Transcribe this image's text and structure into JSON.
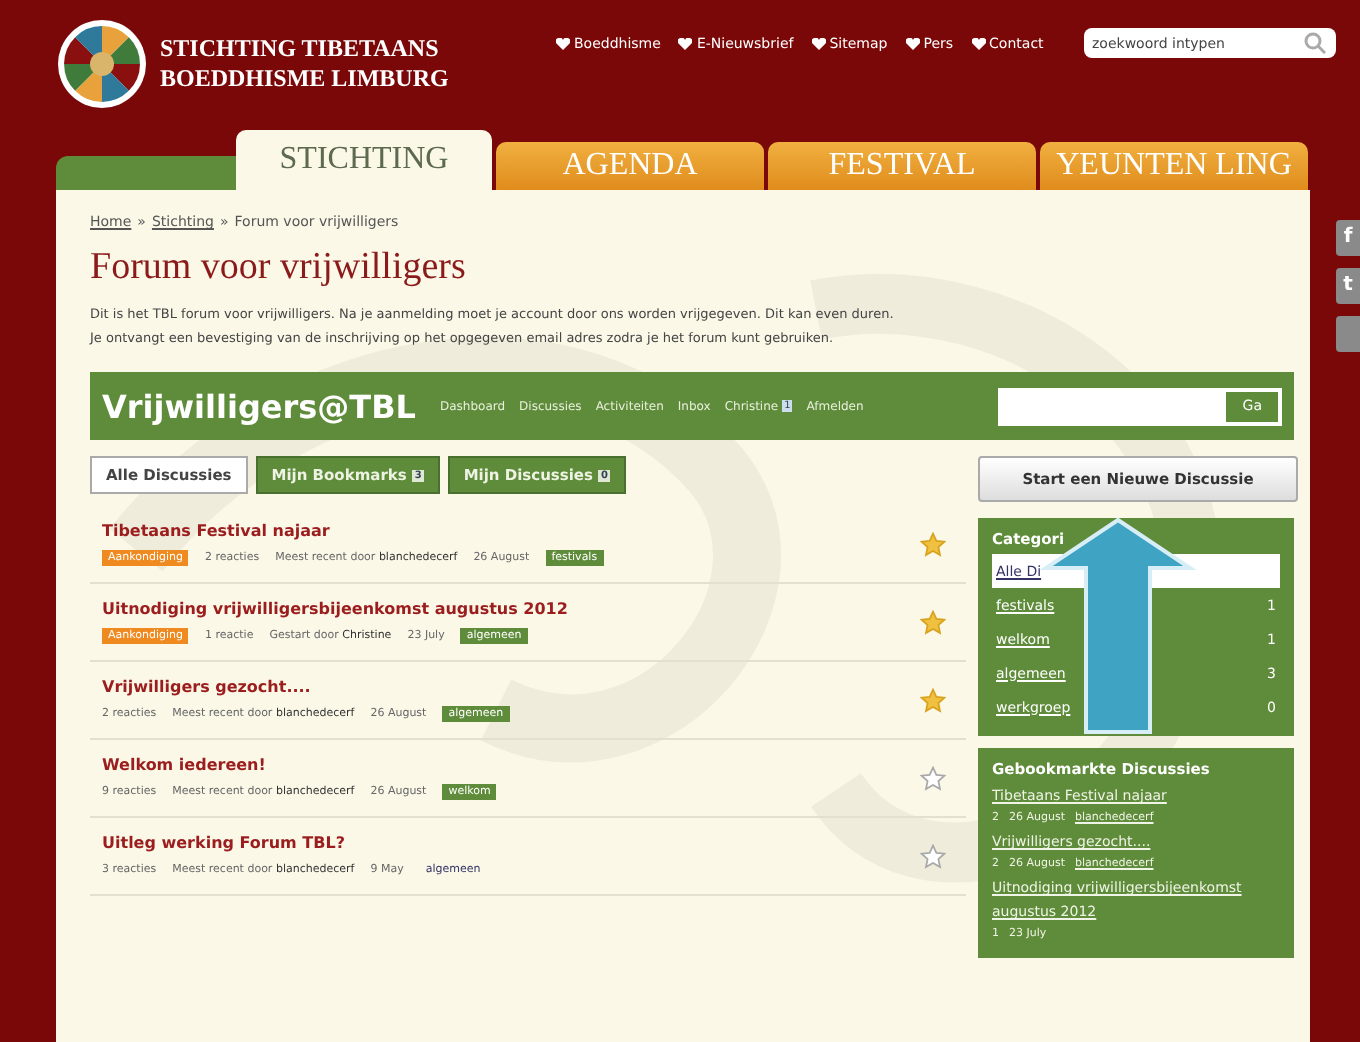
{
  "site": {
    "title_line1": "STICHTING TIBETAANS",
    "title_line2": "BOEDDHISME LIMBURG"
  },
  "top_links": [
    "Boeddhisme",
    "E-Nieuwsbrief",
    "Sitemap",
    "Pers",
    "Contact"
  ],
  "site_search": {
    "placeholder": "zoekwoord intypen"
  },
  "tabs": [
    {
      "label": "STICHTING",
      "selected": true
    },
    {
      "label": "AGENDA",
      "selected": false
    },
    {
      "label": "FESTIVAL",
      "selected": false
    },
    {
      "label": "YEUNTEN LING",
      "selected": false
    }
  ],
  "side_tabs": [
    "f",
    "t"
  ],
  "breadcrumb": [
    {
      "label": "Home",
      "link": true
    },
    {
      "label": "Stichting",
      "link": true
    },
    {
      "label": "Forum voor vrijwilligers",
      "link": false
    }
  ],
  "breadcrumb_separator": "»",
  "page_title": "Forum voor vrijwilligers",
  "intro": [
    "Dit is het TBL forum voor vrijwilligers. Na je aanmelding moet je account door ons worden vrijgegeven. Dit kan even duren.",
    "Je ontvangt een bevestiging van de inschrijving op het opgegeven email adres zodra je het forum kunt gebruiken."
  ],
  "forum": {
    "name": "Vrijwilligers@TBL",
    "nav": [
      {
        "label": "Dashboard"
      },
      {
        "label": "Discussies"
      },
      {
        "label": "Activiteiten"
      },
      {
        "label": "Inbox"
      },
      {
        "label": "Christine",
        "badge": "1"
      },
      {
        "label": "Afmelden"
      }
    ],
    "search_button": "Ga"
  },
  "filters": [
    {
      "label": "Alle Discussies",
      "selected": true
    },
    {
      "label": "Mijn Bookmarks",
      "badge": "3",
      "selected": false
    },
    {
      "label": "Mijn Discussies",
      "badge": "0",
      "selected": false
    }
  ],
  "discussions": [
    {
      "title": "Tibetaans Festival najaar",
      "announcement": "Aankondiging",
      "replies": "2 reacties",
      "by_label": "Meest recent door",
      "author": "blanchedecerf",
      "date": "26 August",
      "tag": {
        "label": "festivals",
        "kind": "green"
      },
      "bookmarked": true
    },
    {
      "title": "Uitnodiging vrijwilligersbijeenkomst augustus 2012",
      "announcement": "Aankondiging",
      "replies": "1 reactie",
      "by_label": "Gestart door",
      "author": "Christine",
      "date": "23 July",
      "tag": {
        "label": "algemeen",
        "kind": "green"
      },
      "bookmarked": true
    },
    {
      "title": "Vrijwilligers gezocht....",
      "replies": "2 reacties",
      "by_label": "Meest recent door",
      "author": "blanchedecerf",
      "date": "26 August",
      "tag": {
        "label": "algemeen",
        "kind": "green"
      },
      "bookmarked": true
    },
    {
      "title": "Welkom iedereen!",
      "replies": "9 reacties",
      "by_label": "Meest recent door",
      "author": "blanchedecerf",
      "date": "26 August",
      "tag": {
        "label": "welkom",
        "kind": "green"
      },
      "bookmarked": false
    },
    {
      "title": "Uitleg werking Forum TBL?",
      "replies": "3 reacties",
      "by_label": "Meest recent door",
      "author": "blanchedecerf",
      "date": "9 May",
      "tag": {
        "label": "algemeen",
        "kind": "plain"
      },
      "bookmarked": false
    }
  ],
  "new_discussion_button": "Start een Nieuwe Discussie",
  "categories": {
    "title": "Categori",
    "items": [
      {
        "label": "Alle Di",
        "selected": true
      },
      {
        "label": "festivals",
        "count": "1",
        "selected": false
      },
      {
        "label": "welkom",
        "count": "1",
        "selected": false
      },
      {
        "label": "algemeen",
        "count": "3",
        "selected": false
      },
      {
        "label": "werkgroep",
        "count": "0",
        "selected": false
      }
    ]
  },
  "bookmarked": {
    "title": "Gebookmarkte Discussies",
    "items": [
      {
        "title": "Tibetaans Festival najaar",
        "count": "2",
        "date": "26 August",
        "author": "blanchedecerf"
      },
      {
        "title": "Vrijwilligers gezocht....",
        "count": "2",
        "date": "26 August",
        "author": "blanchedecerf"
      },
      {
        "title": "Uitnodiging vrijwilligersbijeenkomst augustus 2012",
        "count": "1",
        "date": "23 July"
      }
    ]
  }
}
